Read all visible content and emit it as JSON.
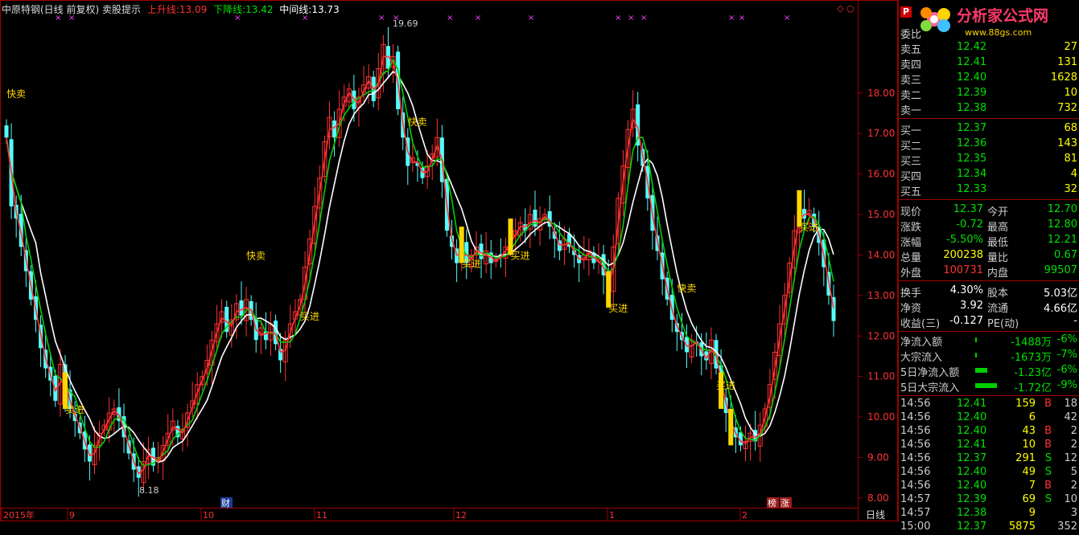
{
  "header": {
    "title": "中原特钢(日线 前复权) 卖股提示",
    "up_label": "上升线:",
    "up_value": "13.09",
    "down_label": "下降线:",
    "down_value": "13.42",
    "mid_label": "中间线:",
    "mid_value": "13.73"
  },
  "colors": {
    "up": "#ff3232",
    "down": "#54ffff",
    "mid": "#ffffff",
    "green": "#00d000",
    "yellow": "#ffd700",
    "grid": "#a00000"
  },
  "chart_data": {
    "type": "candlestick",
    "ylim": [
      7.8,
      19.9
    ],
    "y_ticks": [
      "18.00",
      "17.00",
      "16.00",
      "15.00",
      "14.00",
      "13.00",
      "12.00",
      "11.00",
      "10.00",
      "9.00",
      "8.00"
    ],
    "x_labels": [
      "2015年",
      "9",
      "10",
      "11",
      "12",
      "1",
      "2"
    ],
    "period_label": "日线",
    "markers": [
      "财",
      "榜",
      "涨"
    ],
    "price_annotations": [
      "19.69",
      "8.18"
    ],
    "signals": [
      {
        "text": "快卖",
        "i": 0
      },
      {
        "text": "卖进",
        "i": 12
      },
      {
        "text": "快卖",
        "i": 49
      },
      {
        "text": "买进",
        "i": 60
      },
      {
        "text": "快卖",
        "i": 82
      },
      {
        "text": "买进",
        "i": 93
      },
      {
        "text": "买进",
        "i": 103
      },
      {
        "text": "买进",
        "i": 123
      },
      {
        "text": "快卖",
        "i": 137
      },
      {
        "text": "买进",
        "i": 145
      },
      {
        "text": "买进",
        "i": 162
      },
      {
        "text": "快卖",
        "i": 174
      }
    ],
    "closes": [
      16.9,
      15.2,
      14.9,
      14.2,
      13.6,
      12.9,
      12.4,
      11.7,
      11.2,
      10.9,
      10.4,
      11.3,
      10.6,
      10.2,
      9.9,
      9.6,
      9.2,
      8.9,
      9.3,
      9.6,
      9.8,
      10.1,
      10.2,
      9.9,
      9.5,
      9.1,
      8.7,
      8.5,
      8.9,
      9.2,
      8.8,
      9.0,
      9.3,
      9.6,
      9.9,
      9.5,
      9.7,
      10.1,
      10.4,
      10.8,
      11.0,
      11.4,
      11.9,
      12.3,
      12.6,
      12.1,
      12.4,
      12.8,
      12.5,
      12.9,
      12.4,
      11.9,
      12.2,
      11.9,
      12.3,
      11.8,
      11.4,
      11.9,
      12.3,
      12.6,
      12.9,
      13.7,
      14.4,
      15.2,
      15.9,
      16.8,
      17.4,
      16.9,
      17.6,
      17.9,
      18.1,
      17.6,
      17.9,
      18.2,
      18.4,
      17.8,
      18.6,
      19.2,
      18.6,
      18.9,
      17.6,
      16.9,
      16.2,
      16.4,
      16.2,
      15.9,
      16.2,
      16.5,
      16.9,
      15.8,
      14.6,
      14.2,
      13.8,
      14.2,
      13.8,
      14.0,
      14.2,
      13.9,
      14.1,
      13.8,
      13.9,
      14.0,
      14.2,
      14.4,
      14.6,
      14.8,
      14.6,
      15.0,
      14.7,
      14.9,
      15.0,
      14.7,
      14.4,
      14.1,
      14.4,
      14.2,
      14.0,
      13.8,
      14.0,
      14.1,
      13.8,
      13.9,
      13.5,
      13.1,
      14.2,
      15.4,
      16.2,
      17.1,
      17.6,
      16.7,
      16.2,
      15.4,
      14.6,
      14.1,
      13.4,
      12.9,
      12.4,
      12.1,
      11.9,
      11.6,
      11.9,
      11.8,
      11.5,
      11.4,
      11.9,
      11.2,
      10.6,
      10.1,
      9.7,
      9.5,
      9.3,
      9.4,
      9.6,
      9.4,
      9.8,
      10.2,
      10.8,
      11.6,
      12.3,
      13.0,
      13.8,
      14.6,
      15.1,
      14.9,
      15.1,
      14.7,
      14.3,
      13.7,
      13.0,
      12.37
    ]
  },
  "side": {
    "weibi_label": "委比",
    "sell": [
      {
        "label": "卖五",
        "price": "12.42",
        "vol": "27"
      },
      {
        "label": "卖四",
        "price": "12.41",
        "vol": "131"
      },
      {
        "label": "卖三",
        "price": "12.40",
        "vol": "1628"
      },
      {
        "label": "卖二",
        "price": "12.39",
        "vol": "10"
      },
      {
        "label": "卖一",
        "price": "12.38",
        "vol": "732"
      }
    ],
    "buy": [
      {
        "label": "买一",
        "price": "12.37",
        "vol": "68"
      },
      {
        "label": "买二",
        "price": "12.36",
        "vol": "143"
      },
      {
        "label": "买三",
        "price": "12.35",
        "vol": "81"
      },
      {
        "label": "买四",
        "price": "12.34",
        "vol": "4"
      },
      {
        "label": "买五",
        "price": "12.33",
        "vol": "32"
      }
    ],
    "quote": [
      {
        "l1": "现价",
        "v1": "12.37",
        "c1": "#00e000",
        "l2": "今开",
        "v2": "12.70",
        "c2": "#00e000"
      },
      {
        "l1": "涨跌",
        "v1": "-0.72",
        "c1": "#00e000",
        "l2": "最高",
        "v2": "12.80",
        "c2": "#00e000"
      },
      {
        "l1": "涨幅",
        "v1": "-5.50%",
        "c1": "#00e000",
        "l2": "最低",
        "v2": "12.21",
        "c2": "#00e000"
      },
      {
        "l1": "总量",
        "v1": "200238",
        "c1": "#ffff00",
        "l2": "量比",
        "v2": "0.67",
        "c2": "#00e000"
      },
      {
        "l1": "外盘",
        "v1": "100731",
        "c1": "#ff3232",
        "l2": "内盘",
        "v2": "99507",
        "c2": "#00e000"
      }
    ],
    "fund": [
      {
        "l1": "换手",
        "v1": "4.30%",
        "l2": "股本",
        "v2": "5.03亿"
      },
      {
        "l1": "净资",
        "v1": "3.92",
        "l2": "流通",
        "v2": "4.66亿"
      },
      {
        "l1": "收益(三)",
        "v1": "-0.127",
        "l2": "PE(动)",
        "v2": "-"
      }
    ],
    "flow": [
      {
        "label": "净流入额",
        "bar": 0.02,
        "val": "-1488万",
        "pct": "-6%"
      },
      {
        "label": "大宗流入",
        "bar": 0.02,
        "val": "-1673万",
        "pct": "-7%"
      },
      {
        "label": "5日净流入额",
        "bar": 0.5,
        "val": "-1.23亿",
        "pct": "-6%"
      },
      {
        "label": "5日大宗流入",
        "bar": 0.9,
        "val": "-1.72亿",
        "pct": "-9%"
      }
    ],
    "ticks": [
      {
        "t": "14:56",
        "p": "12.41",
        "v": "159",
        "s": "B",
        "n": "18"
      },
      {
        "t": "14:56",
        "p": "12.40",
        "v": "6",
        "s": "",
        "n": "42"
      },
      {
        "t": "14:56",
        "p": "12.40",
        "v": "43",
        "s": "B",
        "n": "2"
      },
      {
        "t": "14:56",
        "p": "12.41",
        "v": "10",
        "s": "B",
        "n": "2"
      },
      {
        "t": "14:56",
        "p": "12.37",
        "v": "291",
        "s": "S",
        "n": "12"
      },
      {
        "t": "14:56",
        "p": "12.40",
        "v": "49",
        "s": "S",
        "n": "5"
      },
      {
        "t": "14:56",
        "p": "12.40",
        "v": "7",
        "s": "B",
        "n": "2"
      },
      {
        "t": "14:57",
        "p": "12.39",
        "v": "69",
        "s": "S",
        "n": "10"
      },
      {
        "t": "14:57",
        "p": "12.38",
        "v": "9",
        "s": "",
        "n": "3"
      },
      {
        "t": "15:00",
        "p": "12.37",
        "v": "5875",
        "s": "",
        "n": "352"
      }
    ]
  },
  "logo": {
    "text": "分析家公式网",
    "url": "www.88gs.com",
    "badge": "P"
  }
}
